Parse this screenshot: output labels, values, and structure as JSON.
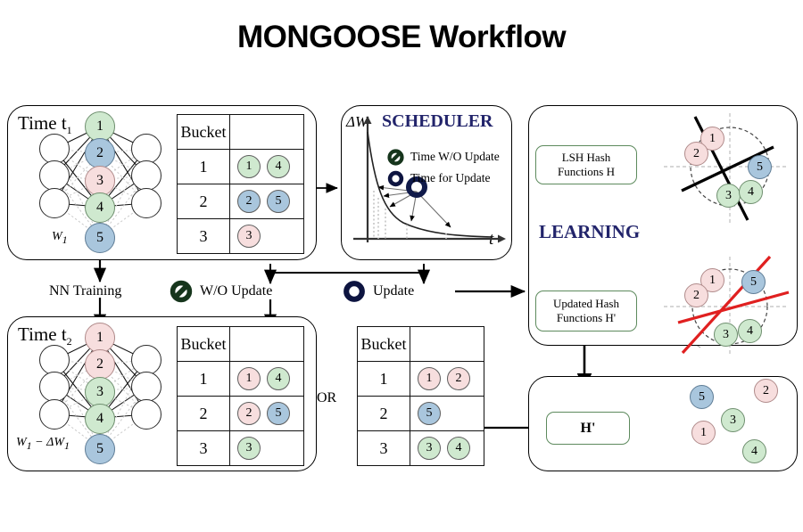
{
  "title": "MONGOOSE Workflow",
  "colors": {
    "green": "#cfe9cf",
    "blue": "#a9c6dd",
    "pink": "#f7dede",
    "navy": "#22246b",
    "red": "#e02020",
    "box_border_green": "#5d8a5d"
  },
  "panel_t1": {
    "time_label": "Time t",
    "time_sub": "1",
    "weight_label": "W",
    "weight_sub": "1",
    "nodes": [
      {
        "id": "1",
        "color": "green"
      },
      {
        "id": "2",
        "color": "blue"
      },
      {
        "id": "3",
        "color": "pink"
      },
      {
        "id": "4",
        "color": "green"
      },
      {
        "id": "5",
        "color": "blue"
      }
    ],
    "hidden_left_count": 3,
    "hidden_right_count": 3
  },
  "table_t1": {
    "header": [
      "Bucket",
      ""
    ],
    "rows": [
      {
        "bucket": "1",
        "items": [
          {
            "id": "1",
            "color": "green"
          },
          {
            "id": "4",
            "color": "green"
          }
        ]
      },
      {
        "bucket": "2",
        "items": [
          {
            "id": "2",
            "color": "blue"
          },
          {
            "id": "5",
            "color": "blue"
          }
        ]
      },
      {
        "bucket": "3",
        "items": [
          {
            "id": "3",
            "color": "pink"
          }
        ]
      }
    ]
  },
  "scheduler": {
    "title": "SCHEDULER",
    "y_axis_label": "ΔW",
    "x_axis_label": "t",
    "legend": [
      {
        "label": "Time W/O Update",
        "icon": "no-update-icon"
      },
      {
        "label": "Time for Update",
        "icon": "update-ring-icon"
      }
    ]
  },
  "learning_panel": {
    "lsh_box_line1": "LSH Hash",
    "lsh_box_line2": "Functions H",
    "learning_label": "LEARNING",
    "updated_box_line1": "Updated Hash",
    "updated_box_line2": "Functions H'",
    "hyperplane_points_top": [
      {
        "id": "1",
        "color": "pink"
      },
      {
        "id": "2",
        "color": "pink"
      },
      {
        "id": "5",
        "color": "blue"
      },
      {
        "id": "3",
        "color": "green"
      },
      {
        "id": "4",
        "color": "green"
      }
    ],
    "hyperplane_points_bottom": [
      {
        "id": "1",
        "color": "pink"
      },
      {
        "id": "2",
        "color": "pink"
      },
      {
        "id": "5",
        "color": "blue"
      },
      {
        "id": "3",
        "color": "green"
      },
      {
        "id": "4",
        "color": "green"
      }
    ]
  },
  "flow_labels": {
    "nn_training": "NN Training",
    "wo_update": "W/O Update",
    "update": "Update",
    "or_label": "OR"
  },
  "panel_t2": {
    "time_label": "Time t",
    "time_sub": "2",
    "weight_label": "W",
    "weight_sub_1": "1",
    "weight_minus": " − ΔW",
    "weight_sub_2": "1",
    "nodes": [
      {
        "id": "1",
        "color": "pink"
      },
      {
        "id": "2",
        "color": "pink"
      },
      {
        "id": "3",
        "color": "green"
      },
      {
        "id": "4",
        "color": "green"
      },
      {
        "id": "5",
        "color": "blue"
      }
    ]
  },
  "table_wo_update": {
    "header": [
      "Bucket",
      ""
    ],
    "rows": [
      {
        "bucket": "1",
        "items": [
          {
            "id": "1",
            "color": "pink"
          },
          {
            "id": "4",
            "color": "green"
          }
        ]
      },
      {
        "bucket": "2",
        "items": [
          {
            "id": "2",
            "color": "pink"
          },
          {
            "id": "5",
            "color": "blue"
          }
        ]
      },
      {
        "bucket": "3",
        "items": [
          {
            "id": "3",
            "color": "green"
          }
        ]
      }
    ]
  },
  "table_update": {
    "header": [
      "Bucket",
      ""
    ],
    "rows": [
      {
        "bucket": "1",
        "items": [
          {
            "id": "1",
            "color": "pink"
          },
          {
            "id": "2",
            "color": "pink"
          }
        ]
      },
      {
        "bucket": "2",
        "items": [
          {
            "id": "5",
            "color": "blue"
          }
        ]
      },
      {
        "bucket": "3",
        "items": [
          {
            "id": "3",
            "color": "green"
          },
          {
            "id": "4",
            "color": "green"
          }
        ]
      }
    ]
  },
  "hprime_panel": {
    "box_label": "H'",
    "scatter": [
      {
        "id": "5",
        "color": "blue"
      },
      {
        "id": "2",
        "color": "pink"
      },
      {
        "id": "3",
        "color": "green"
      },
      {
        "id": "1",
        "color": "pink"
      },
      {
        "id": "4",
        "color": "green"
      }
    ]
  }
}
